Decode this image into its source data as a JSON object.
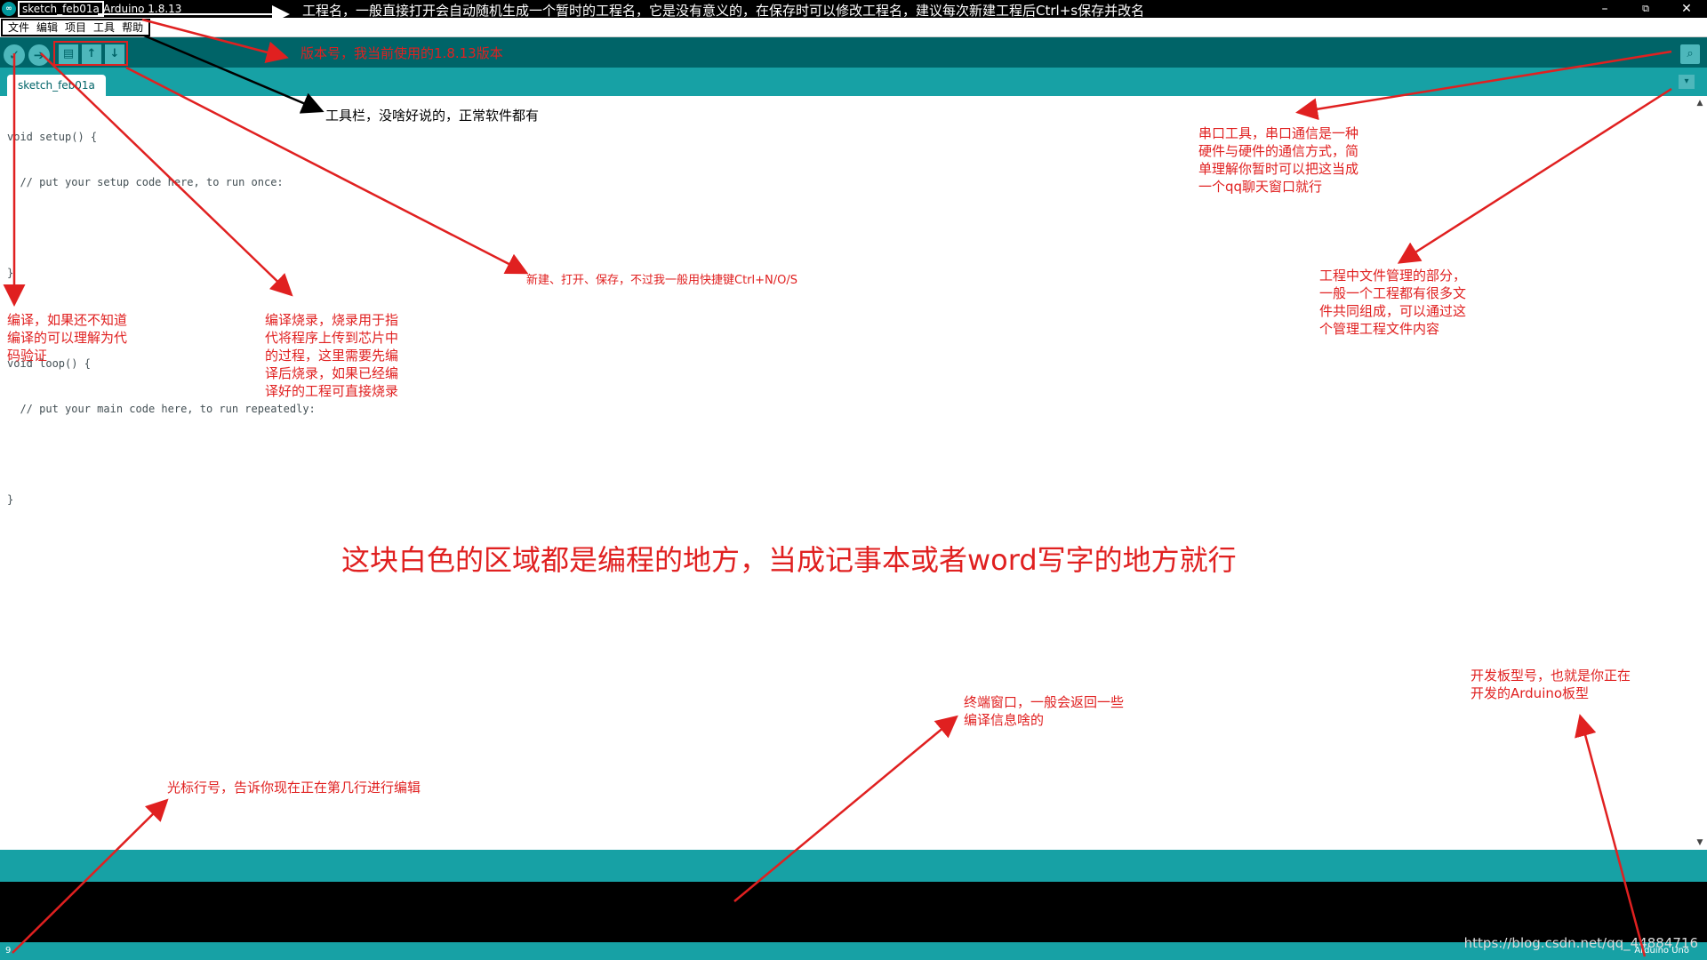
{
  "window": {
    "sketch_name": "sketch_feb01a",
    "version": "Arduino 1.8.13",
    "minimize": "–",
    "restore": "⧉",
    "close": "✕"
  },
  "menu": {
    "items": [
      {
        "label": "文件"
      },
      {
        "label": "编辑"
      },
      {
        "label": "项目"
      },
      {
        "label": "工具"
      },
      {
        "label": "帮助"
      }
    ]
  },
  "toolbar": {
    "verify_icon": "✓",
    "upload_icon": "➔",
    "new_icon": "▤",
    "open_icon": "↑",
    "save_icon": "↓",
    "serial_icon": "⌕"
  },
  "tabs": {
    "active": "sketch_feb01a",
    "menu_icon": "▾"
  },
  "editor": {
    "lines": [
      "void setup() {",
      "  // put your setup code here, to run once:",
      "",
      "}",
      "",
      "void loop() {",
      "  // put your main code here, to run repeatedly:",
      "",
      "}"
    ]
  },
  "status": {
    "line_number": "9",
    "board": "Arduino Uno"
  },
  "watermark": "https://blog.csdn.net/qq_44884716",
  "annotations": {
    "title": "工程名，一般直接打开会自动随机生成一个暂时的工程名，它是没有意义的，在保存时可以修改工程名，建议每次新建工程后Ctrl+s保存并改名",
    "version": "版本号，我当前使用的1.8.13版本",
    "toolbar": "工具栏，没啥好说的，正常软件都有",
    "files": "新建、打开、保存，不过我一般用快捷键Ctrl+N/O/S",
    "verify": "编译，如果还不知道编译的可以理解为代码验证",
    "upload": "编译烧录，烧录用于指代将程序上传到芯片中的过程，这里需要先编译后烧录，如果已经编译好的工程可直接烧录",
    "serial": "串口工具，串口通信是一种硬件与硬件的通信方式，简单理解你暂时可以把这当成一个qq聊天窗口就行",
    "tab_menu": "工程中文件管理的部分，一般一个工程都有很多文件共同组成，可以通过这个管理工程文件内容",
    "editor": "这块白色的区域都是编程的地方，当成记事本或者word写字的地方就行",
    "console": "终端窗口，一般会返回一些编译信息啥的",
    "board": "开发板型号，也就是你正在开发的Arduino板型",
    "line": "光标行号，告诉你现在正在第几行进行编辑"
  },
  "colors": {
    "teal_dark": "#006468",
    "teal": "#17a1a5",
    "annotation_red": "#e02020"
  }
}
